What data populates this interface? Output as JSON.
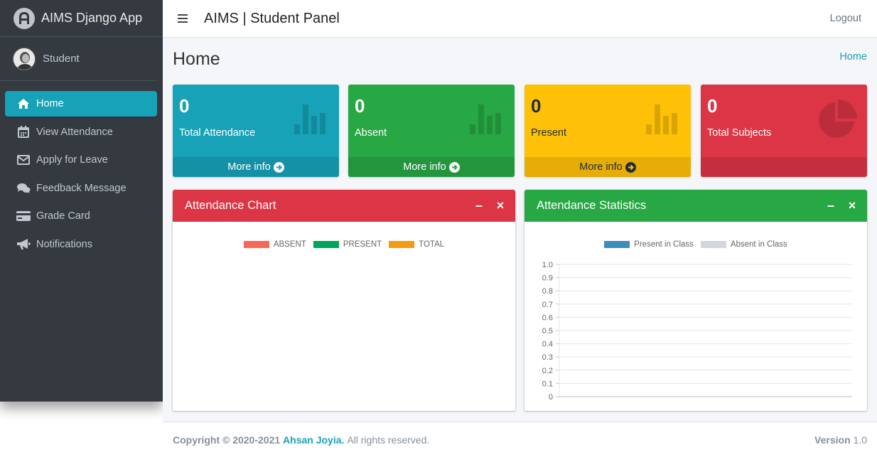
{
  "brand": {
    "title": "AIMS Django App"
  },
  "user": {
    "name": "Student"
  },
  "sidebar": {
    "items": [
      {
        "label": "Home",
        "icon": "home-icon",
        "active": true
      },
      {
        "label": "View Attendance",
        "icon": "calendar-icon"
      },
      {
        "label": "Apply for Leave",
        "icon": "envelope-icon"
      },
      {
        "label": "Feedback Message",
        "icon": "comments-icon"
      },
      {
        "label": "Grade Card",
        "icon": "credit-card-icon"
      },
      {
        "label": "Notifications",
        "icon": "bullhorn-icon"
      }
    ]
  },
  "header": {
    "title": "AIMS | Student Panel",
    "logout": "Logout"
  },
  "page": {
    "title": "Home",
    "breadcrumb": "Home"
  },
  "stats": [
    {
      "value": "0",
      "label": "Total Attendance",
      "footer": "More info",
      "color": "#17a2b8"
    },
    {
      "value": "0",
      "label": "Absent",
      "footer": "More info",
      "color": "#28a745"
    },
    {
      "value": "0",
      "label": "Present",
      "footer": "More info",
      "color": "#ffc107"
    },
    {
      "value": "0",
      "label": "Total Subjects",
      "footer": "",
      "color": "#dc3545"
    }
  ],
  "attendance_chart": {
    "title": "Attendance Chart",
    "legend": [
      {
        "label": "ABSENT",
        "color": "#f56954"
      },
      {
        "label": "PRESENT",
        "color": "#00a65a"
      },
      {
        "label": "TOTAL",
        "color": "#f39c12"
      }
    ]
  },
  "chart_data": {
    "type": "bar",
    "title": "Attendance Statistics",
    "series": [
      {
        "name": "Present in Class",
        "color": "#3c8dbc",
        "values": []
      },
      {
        "name": "Absent in Class",
        "color": "#d2d6de",
        "values": []
      }
    ],
    "yticks": [
      "1.0",
      "0.9",
      "0.8",
      "0.7",
      "0.6",
      "0.5",
      "0.4",
      "0.3",
      "0.2",
      "0.1",
      "0"
    ],
    "ylim": [
      0,
      1
    ],
    "grid": true,
    "legend_position": "top"
  },
  "footer": {
    "copyright": "Copyright © 2020-2021",
    "author": "Ahsan Joyia.",
    "rights": "All rights reserved.",
    "version_label": "Version",
    "version": "1.0"
  }
}
